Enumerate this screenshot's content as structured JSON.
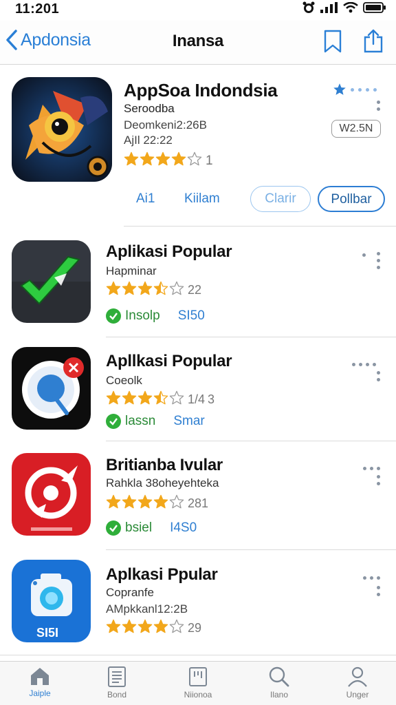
{
  "status_bar": {
    "time": "11:201"
  },
  "nav": {
    "back_label": "Apdonsia",
    "title": "Inansa"
  },
  "featured": {
    "name": "AppSoa Indondsia",
    "subtitle": "Seroodba",
    "line1": "Deomkeni2:26B",
    "line2": "AjIl 22:22",
    "rating_count": "1",
    "rating": 4,
    "price": "W2.5N",
    "actions": {
      "a1": "Ai1",
      "a2": "Kiilam",
      "clear": "Clarir",
      "follow": "Pollbar"
    }
  },
  "apps": [
    {
      "name": "Aplikasi Popular",
      "subtitle": "Hapminar",
      "rating_num": "22",
      "rating": 3.5,
      "status": "Insolp",
      "price": "SI50"
    },
    {
      "name": "Apllkasi Popular",
      "subtitle": "Coeolk",
      "rating_num": "3",
      "rating_prefix": "1/4",
      "rating": 3.5,
      "status": "lassn",
      "price": "Smar"
    },
    {
      "name": "Britianba Ivular",
      "subtitle": "Rahkla 38oheyehteka",
      "rating_num": "281",
      "rating": 4,
      "status": "bsiel",
      "price": "I4S0"
    },
    {
      "name": "Aplkasi Ppular",
      "subtitle": "Copranfe",
      "line2": "AMpkkanl12:2B",
      "rating_num": "29",
      "rating": 4
    }
  ],
  "icon_labels": {
    "app4_badge": "SI5I"
  },
  "tabs": [
    {
      "label": "Jaiple",
      "icon": "house-icon"
    },
    {
      "label": "Bond",
      "icon": "news-icon"
    },
    {
      "label": "Niionoa",
      "icon": "apps-icon"
    },
    {
      "label": "Ilano",
      "icon": "search-icon"
    },
    {
      "label": "Unger",
      "icon": "person-icon"
    }
  ],
  "colors": {
    "accent": "#2f7fd1",
    "star": "#f2a71b",
    "check": "#2fae3a"
  }
}
